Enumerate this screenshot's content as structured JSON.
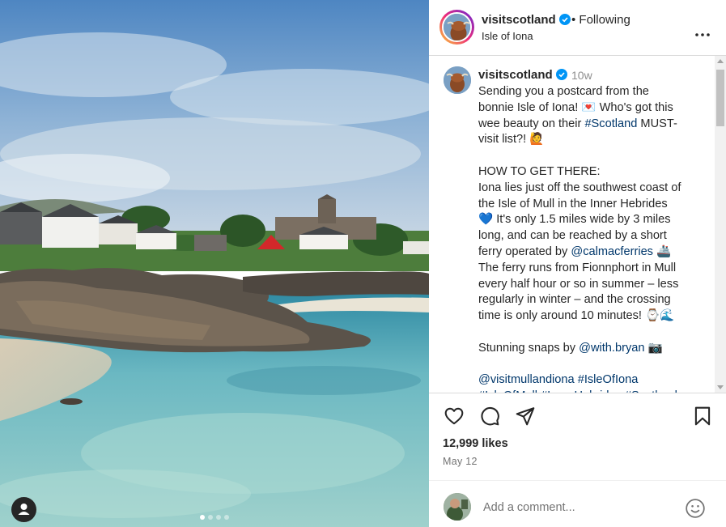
{
  "post": {
    "username": "visitscotland",
    "follow_status": "Following",
    "location": "Isle of Iona",
    "time_ago": "10w",
    "caption_lines": [
      "Sending you a postcard from the",
      "bonnie Isle of Iona! 💌 Who's got this",
      "wee beauty on their #Scotland MUST-",
      "visit list?! 🙋",
      "",
      "HOW TO GET THERE:",
      "Iona lies just off the southwest coast of",
      "the Isle of Mull in the Inner Hebrides",
      "💙 It's only 1.5 miles wide by 3 miles",
      "long, and can be reached by a short",
      "ferry operated by @calmacferries 🚢",
      "The ferry runs from Fionnphort in Mull",
      "every half hour or so in summer – less",
      "regularly in winter – and the crossing",
      "time is only around 10 minutes! ⌚🌊",
      "",
      "Stunning snaps by @with.bryan 📷",
      "",
      "@visitmullandiona #IsleOfIona",
      "#IsleOfMull #InnerHebrides #Scotland"
    ],
    "likes": "12,999 likes",
    "date": "May 12",
    "comment_placeholder": "Add a comment..."
  },
  "icons": {
    "verified": "verified-badge-icon",
    "more": "more-options-icon",
    "like": "heart-icon",
    "comment": "comment-icon",
    "share": "share-icon",
    "save": "bookmark-icon",
    "emoji": "emoji-icon",
    "tagged": "user-tag-icon"
  },
  "colors": {
    "verified": "#0095f6",
    "hashtag": "#00376b",
    "muted": "#737373"
  },
  "carousel": {
    "current": 1,
    "total": 4
  }
}
